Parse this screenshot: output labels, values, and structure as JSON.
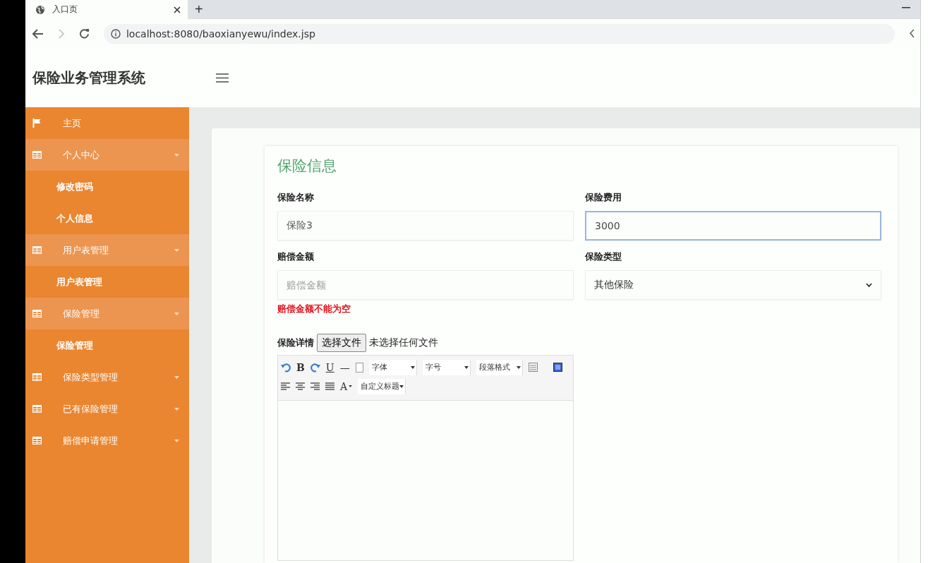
{
  "browser": {
    "tab_title": "入口页",
    "new_tab": "+",
    "address": "localhost:8080/baoxianyewu/index.jsp"
  },
  "header": {
    "title": "保险业务管理系统"
  },
  "sidebar": {
    "items": [
      {
        "label": "主页",
        "kind": "home",
        "expanded": false
      },
      {
        "label": "个人中心",
        "kind": "group",
        "expanded": true,
        "children": [
          {
            "label": "修改密码"
          },
          {
            "label": "个人信息"
          }
        ]
      },
      {
        "label": "用户表管理",
        "kind": "group",
        "expanded": true,
        "children": [
          {
            "label": "用户表管理"
          }
        ]
      },
      {
        "label": "保险管理",
        "kind": "group",
        "expanded": true,
        "children": [
          {
            "label": "保险管理"
          }
        ]
      },
      {
        "label": "保险类型管理",
        "kind": "group",
        "expanded": false
      },
      {
        "label": "已有保险管理",
        "kind": "group",
        "expanded": false
      },
      {
        "label": "赔偿申请管理",
        "kind": "group",
        "expanded": false
      }
    ]
  },
  "form": {
    "title": "保险信息",
    "fields": [
      {
        "label": "保险名称",
        "kind": "input",
        "value": "保险3",
        "focused": false
      },
      {
        "label": "保险费用",
        "kind": "input",
        "value": "3000",
        "focused": true
      },
      {
        "label": "赔偿金额",
        "kind": "input",
        "placeholder": "赔偿金额",
        "focused": false,
        "error": "赔偿金额不能为空"
      },
      {
        "label": "保险类型",
        "kind": "select",
        "value": "其他保险",
        "focused": false
      }
    ],
    "details": {
      "label": "保险详情",
      "file_button": "选择文件",
      "file_status": "未选择任何文件",
      "toolbar_texts": [
        "B",
        "U",
        "—",
        "A"
      ],
      "selects": [
        "字体",
        "字号",
        "段落格式",
        "自定义标题"
      ]
    }
  }
}
